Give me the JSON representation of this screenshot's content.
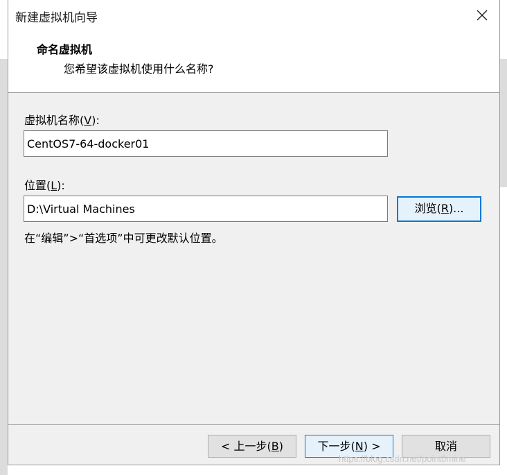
{
  "window": {
    "title": "新建虚拟机向导",
    "close_icon": "close-icon"
  },
  "header": {
    "title": "命名虚拟机",
    "subtitle": "您希望该虚拟机使用什么名称?"
  },
  "form": {
    "name_label_prefix": "虚拟机名称(",
    "name_label_key": "V",
    "name_label_suffix": "):",
    "name_value": "CentOS7-64-docker01",
    "location_label_prefix": "位置(",
    "location_label_key": "L",
    "location_label_suffix": "):",
    "location_value": "D:\\Virtual Machines",
    "browse_prefix": "浏览(",
    "browse_key": "R",
    "browse_suffix": ")...",
    "hint": "在“编辑”>“首选项”中可更改默认位置。"
  },
  "footer": {
    "back_prefix": "< 上一步(",
    "back_key": "B",
    "back_suffix": ")",
    "next_prefix": "下一步(",
    "next_key": "N",
    "next_suffix": ") >",
    "cancel_label": "取消"
  },
  "watermark": "https://blog.csdn.net/point0mine",
  "colors": {
    "accent": "#0078d7",
    "panel_bg": "#f0f0f0"
  }
}
